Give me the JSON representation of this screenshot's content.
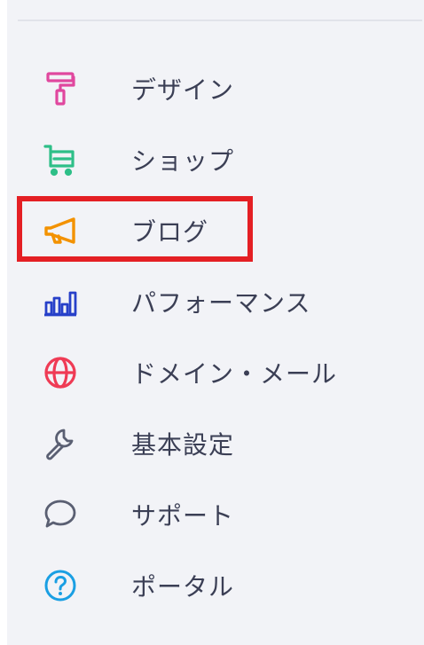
{
  "sidebar": {
    "items": [
      {
        "label": "デザイン",
        "icon": "paint-roller-icon",
        "color": "#e0479e"
      },
      {
        "label": "ショップ",
        "icon": "shopping-cart-icon",
        "color": "#2ebf88"
      },
      {
        "label": "ブログ",
        "icon": "megaphone-icon",
        "color": "#f39200"
      },
      {
        "label": "パフォーマンス",
        "icon": "bar-chart-icon",
        "color": "#2740c9"
      },
      {
        "label": "ドメイン・メール",
        "icon": "globe-icon",
        "color": "#ef3b55"
      },
      {
        "label": "基本設定",
        "icon": "wrench-icon",
        "color": "#5a5f72"
      },
      {
        "label": "サポート",
        "icon": "speech-bubble-icon",
        "color": "#5a5f72"
      },
      {
        "label": "ポータル",
        "icon": "help-circle-icon",
        "color": "#1a9fe3"
      }
    ],
    "highlighted_item": "ブログ",
    "highlight_color": "#e41f24"
  }
}
